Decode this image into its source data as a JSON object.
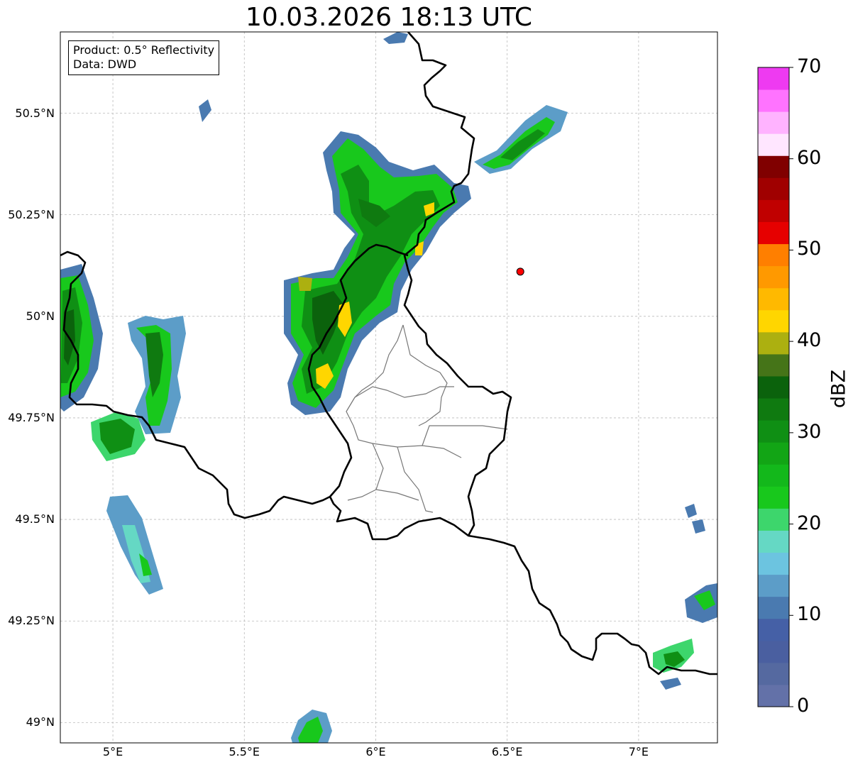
{
  "title": "10.03.2026 18:13 UTC",
  "infobox": {
    "product": "Product: 0.5° Reflectivity",
    "data": "Data: DWD"
  },
  "axes": {
    "lon_range": [
      4.8,
      7.3
    ],
    "lat_range": [
      48.95,
      50.7
    ],
    "x_ticks": [
      {
        "value": 5.0,
        "label": "5°E"
      },
      {
        "value": 5.5,
        "label": "5.5°E"
      },
      {
        "value": 6.0,
        "label": "6°E"
      },
      {
        "value": 6.5,
        "label": "6.5°E"
      },
      {
        "value": 7.0,
        "label": "7°E"
      }
    ],
    "y_ticks": [
      {
        "value": 50.5,
        "label": "50.5°N"
      },
      {
        "value": 50.25,
        "label": "50.25°N"
      },
      {
        "value": 50.0,
        "label": "50°N"
      },
      {
        "value": 49.75,
        "label": "49.75°N"
      },
      {
        "value": 49.5,
        "label": "49.5°N"
      },
      {
        "value": 49.25,
        "label": "49.25°N"
      },
      {
        "value": 49.0,
        "label": "49°N"
      }
    ],
    "grid": true
  },
  "marker": {
    "lon": 6.55,
    "lat": 50.11,
    "color": "#ff0000"
  },
  "colorbar": {
    "label": "dBZ",
    "min": 0,
    "max": 70,
    "ticks": [
      "0",
      "10",
      "20",
      "30",
      "40",
      "50",
      "60",
      "70"
    ],
    "colors": [
      "#6371a8",
      "#5569a0",
      "#4a5fa0",
      "#4560a6",
      "#4a7ab0",
      "#5c9dc8",
      "#6cc4e0",
      "#65d8c4",
      "#3dd66c",
      "#18c81c",
      "#13b81b",
      "#12a515",
      "#0f8f14",
      "#0f7a10",
      "#0b620c",
      "#457418",
      "#acb010",
      "#ffd600",
      "#ffb900",
      "#ff9900",
      "#ff7f00",
      "#e60000",
      "#c00000",
      "#a00000",
      "#800000",
      "#ffe6ff",
      "#ffb3ff",
      "#ff73ff",
      "#ee3af1"
    ]
  }
}
